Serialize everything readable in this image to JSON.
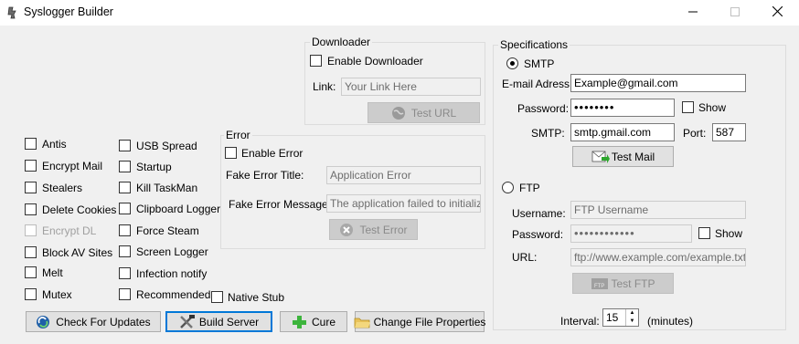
{
  "window": {
    "title": "Syslogger Builder",
    "minimize_icon": "minimize-icon",
    "maximize_icon": "maximize-icon",
    "close_icon": "close-icon"
  },
  "options": {
    "col1": [
      {
        "label": "Antis",
        "checked": false,
        "enabled": true
      },
      {
        "label": "Encrypt Mail",
        "checked": false,
        "enabled": true
      },
      {
        "label": "Stealers",
        "checked": false,
        "enabled": true
      },
      {
        "label": "Delete Cookies",
        "checked": false,
        "enabled": true
      },
      {
        "label": "Encrypt DL",
        "checked": false,
        "enabled": false
      },
      {
        "label": "Block AV Sites",
        "checked": false,
        "enabled": true
      },
      {
        "label": "Melt",
        "checked": false,
        "enabled": true
      },
      {
        "label": "Mutex",
        "checked": false,
        "enabled": true
      }
    ],
    "col2": [
      {
        "label": "USB Spread",
        "checked": false,
        "enabled": true
      },
      {
        "label": "Startup",
        "checked": false,
        "enabled": true
      },
      {
        "label": "Kill TaskMan",
        "checked": false,
        "enabled": true
      },
      {
        "label": "Clipboard Logger",
        "checked": false,
        "enabled": true
      },
      {
        "label": "Force Steam",
        "checked": false,
        "enabled": true
      },
      {
        "label": "Screen Logger",
        "checked": false,
        "enabled": true
      },
      {
        "label": "Infection notify",
        "checked": false,
        "enabled": true
      },
      {
        "label": "Recommended",
        "checked": false,
        "enabled": true
      }
    ],
    "native_stub": "Native Stub"
  },
  "downloader": {
    "title": "Downloader",
    "enable_label": "Enable Downloader",
    "link_label": "Link:",
    "link_placeholder": "Your Link Here",
    "test_url_label": "Test URL"
  },
  "error": {
    "title": "Error",
    "enable_label": "Enable Error",
    "fake_title_label": "Fake Error Title:",
    "fake_title_value": "Application Error",
    "fake_message_label": "Fake Error Message:",
    "fake_message_value": "The application failed to initialize pr",
    "test_error_label": "Test Error"
  },
  "buttons": {
    "check_updates": "Check For Updates",
    "build_server": "Build Server",
    "cure": "Cure",
    "change_file_properties": "Change File Properties"
  },
  "specs": {
    "title": "Specifications",
    "smtp_label": "SMTP",
    "smtp_selected": true,
    "email_label": "E-mail Adress:",
    "email_value": "Example@gmail.com",
    "password_label": "Password:",
    "password_value": "••••••••",
    "show_label": "Show",
    "smtp_label2": "SMTP:",
    "smtp_value": "smtp.gmail.com",
    "port_label": "Port:",
    "port_value": "587",
    "test_mail_label": "Test Mail",
    "ftp_label": "FTP",
    "ftp_selected": false,
    "username_label": "Username:",
    "username_placeholder": "FTP Username",
    "ftp_password_label": "Password:",
    "ftp_password_value": "••••••••••••",
    "ftp_show_label": "Show",
    "url_label": "URL:",
    "url_placeholder": "ftp://www.example.com/example.txt",
    "test_ftp_label": "Test FTP",
    "interval_label": "Interval:",
    "interval_value": "15",
    "interval_unit": "(minutes)"
  }
}
